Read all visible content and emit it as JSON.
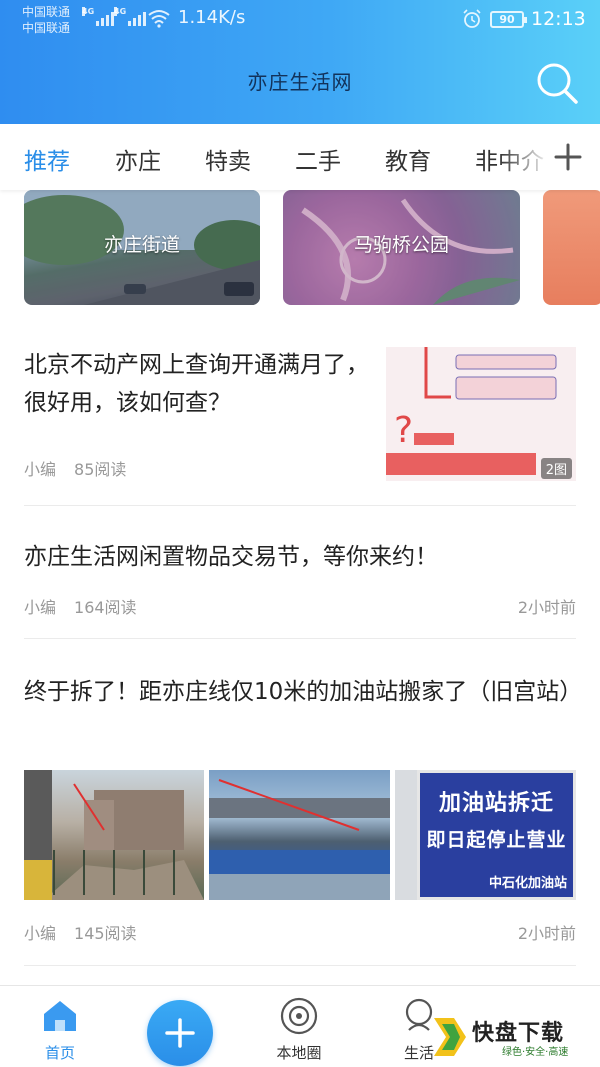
{
  "status_bar": {
    "carrier_1": "中国联通",
    "carrier_2": "中国联通",
    "network_1": "4G",
    "network_2": "4G",
    "net_speed": "1.14K/s",
    "battery": "90",
    "time": "12:13"
  },
  "header": {
    "title": "亦庄生活网",
    "search_icon": "search-icon"
  },
  "tabs": {
    "items": [
      "推荐",
      "亦庄",
      "特卖",
      "二手",
      "教育",
      "非中介"
    ],
    "active_index": 0,
    "add_icon": "plus-icon"
  },
  "cards": [
    {
      "label": "亦庄街道"
    },
    {
      "label": "马驹桥公园"
    },
    {
      "label": ""
    }
  ],
  "articles": [
    {
      "title": "北京不动产网上查询开通满月了，很好用，该如何查？",
      "author": "小编",
      "reads": "85阅读",
      "time": "",
      "badge": "2图"
    },
    {
      "title": "亦庄生活网闲置物品交易节，等你来约！",
      "author": "小编",
      "reads": "164阅读",
      "time": "2小时前"
    },
    {
      "title": "终于拆了！距亦庄线仅10米的加油站搬家了（旧宫站）",
      "author": "小编",
      "reads": "145阅读",
      "time": "2小时前",
      "sign_line_1": "加油站拆迁",
      "sign_line_2": "即日起停止营业",
      "sign_small": "中石化加油站"
    }
  ],
  "bottom_nav": {
    "items": [
      {
        "label": "首页",
        "icon": "home-icon"
      },
      {
        "label": "本地圈",
        "icon": "circle-icon"
      },
      {
        "label": "生活",
        "icon": "life-icon"
      }
    ],
    "fab_icon": "plus-icon",
    "active_index": 0
  },
  "watermark": {
    "brand": "快盘下载",
    "slogan": "绿色·安全·高速"
  },
  "colors": {
    "accent": "#2a8ee8",
    "header_start": "#2f8df0",
    "header_end": "#5ad0f8"
  }
}
